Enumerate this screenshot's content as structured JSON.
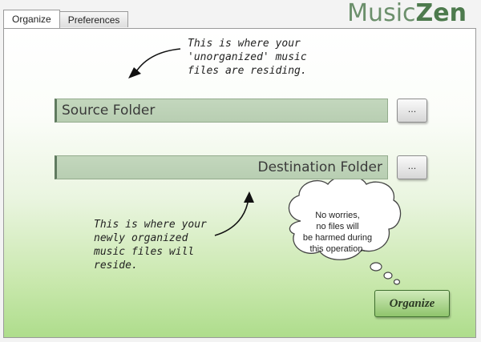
{
  "tabs": [
    {
      "label": "Organize",
      "active": true
    },
    {
      "label": "Preferences",
      "active": false
    }
  ],
  "logo": {
    "part1": "Music",
    "part2": "Zen"
  },
  "source_note": [
    "This is where your",
    "'unorganized' music",
    "files are residing."
  ],
  "source_field": {
    "label": "Source Folder"
  },
  "source_browse": {
    "label": "..."
  },
  "destination_field": {
    "label": "Destination Folder"
  },
  "destination_browse": {
    "label": "..."
  },
  "destination_note": [
    "This is where your",
    "newly organized",
    "music files will",
    "reside."
  ],
  "reassurance": [
    "No worries,",
    "no files will",
    "be harmed during",
    "this operation."
  ],
  "organize_button": {
    "label": "Organize"
  },
  "colors": {
    "field_bg": "#bfd4b9",
    "field_accent": "#5f7a5f",
    "gradient_bottom": "#aedd8c",
    "logo": "#6b8f6b"
  }
}
